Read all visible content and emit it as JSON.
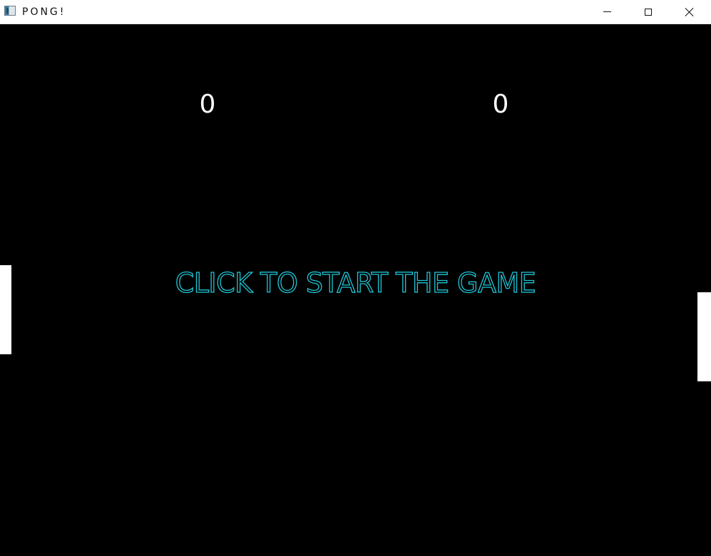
{
  "window": {
    "title": "PONG!",
    "icon": "app-window-icon",
    "controls": {
      "minimize": "minimize-icon",
      "maximize": "maximize-icon",
      "close": "close-icon"
    }
  },
  "game": {
    "background_color": "#000000",
    "score": {
      "left": "0",
      "right": "0"
    },
    "message": "CLICK TO START THE GAME",
    "message_color": "#1fc6d6",
    "paddle_color": "#ffffff"
  }
}
